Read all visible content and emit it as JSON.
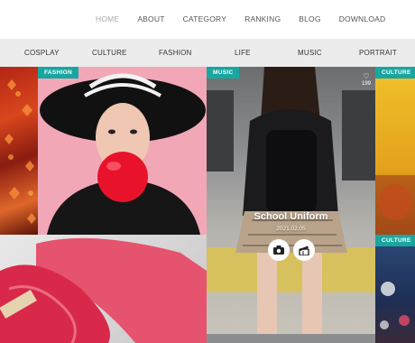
{
  "topnav": {
    "items": [
      {
        "label": "HOME",
        "active": true
      },
      {
        "label": "ABOUT",
        "active": false
      },
      {
        "label": "CATEGORY",
        "active": false
      },
      {
        "label": "RANKING",
        "active": false
      },
      {
        "label": "BLOG",
        "active": false
      },
      {
        "label": "DOWNLOAD",
        "active": false
      }
    ]
  },
  "categories": [
    "COSPLAY",
    "CULTURE",
    "FASHION",
    "LIFE",
    "MUSIC",
    "PORTRAIT"
  ],
  "tiles": {
    "fashion": {
      "badge": "FASHION"
    },
    "music": {
      "badge": "MUSIC",
      "title": "School Uniform",
      "date": "2021.02.05",
      "likes": "199"
    },
    "culture1": {
      "badge": "CULTURE"
    },
    "culture2": {
      "badge": "CULTURE"
    }
  },
  "colors": {
    "accent": "#1aa6a0",
    "catbar": "#ececec"
  },
  "icons": [
    "heart-icon",
    "camera-icon",
    "film-icon"
  ]
}
